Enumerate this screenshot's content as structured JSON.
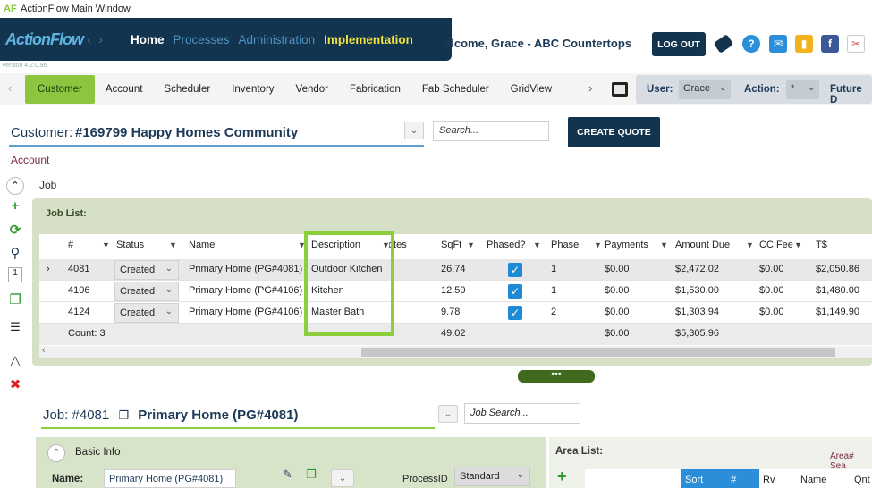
{
  "window": {
    "title": "ActionFlow Main Window"
  },
  "header": {
    "logo": "ActionFlow",
    "version": "Version 4.2.0.96",
    "nav": {
      "home": "Home",
      "processes": "Processes",
      "administration": "Administration",
      "implementation": "Implementation"
    },
    "welcome": "elcome, Grace - ABC Countertops",
    "logout": "LOG OUT"
  },
  "tabs": [
    "Customer",
    "Account",
    "Scheduler",
    "Inventory",
    "Vendor",
    "Fabrication",
    "Fab Scheduler",
    "GridView"
  ],
  "filters": {
    "user_label": "User:",
    "user_value": "Grace",
    "action_label": "Action:",
    "action_value": "*",
    "future_label": "Future D"
  },
  "customer": {
    "label": "Customer:",
    "value": "#169799  Happy Homes Community",
    "search_placeholder": "Search...",
    "create_quote": "CREATE QUOTE"
  },
  "account_label": "Account",
  "job_label": "Job",
  "job_list": {
    "title": "Job List:",
    "columns": [
      "#",
      "Status",
      "Name",
      "Description",
      "Notes",
      "SqFt",
      "Phased?",
      "Phase",
      "Payments",
      "Amount Due",
      "CC Fee",
      "T$"
    ],
    "rows": [
      {
        "num": "4081",
        "status": "Created",
        "name": "Primary Home (PG#4081)",
        "desc": "Outdoor Kitchen",
        "sqft": "26.74",
        "phase": "1",
        "payments": "$0.00",
        "due": "$2,472.02",
        "cc": "$0.00",
        "t": "$2,050.86"
      },
      {
        "num": "4106",
        "status": "Created",
        "name": "Primary Home (PG#4106)",
        "desc": "Kitchen",
        "sqft": "12.50",
        "phase": "1",
        "payments": "$0.00",
        "due": "$1,530.00",
        "cc": "$0.00",
        "t": "$1,480.00"
      },
      {
        "num": "4124",
        "status": "Created",
        "name": "Primary Home (PG#4106)",
        "desc": "Master Bath",
        "sqft": "9.78",
        "phase": "2",
        "payments": "$0.00",
        "due": "$1,303.94",
        "cc": "$0.00",
        "t": "$1,149.90"
      }
    ],
    "footer": {
      "count": "Count: 3",
      "sqft": "49.02",
      "payments": "$0.00",
      "due": "$5,305.96"
    },
    "side_count": "1",
    "splitter": "•••"
  },
  "job": {
    "header": "Job:  #4081",
    "name": "Primary Home (PG#4081)",
    "search_placeholder": "Job Search..."
  },
  "basic_info": {
    "title": "Basic Info",
    "name_label": "Name:",
    "name_value": "Primary Home (PG#4081)",
    "process_label": "ProcessID",
    "process_value": "Standard"
  },
  "area_list": {
    "title": "Area List:",
    "search": "Area# Sea",
    "cols": [
      "Sort",
      "#",
      "Rv",
      "Name",
      "Qnt"
    ]
  }
}
